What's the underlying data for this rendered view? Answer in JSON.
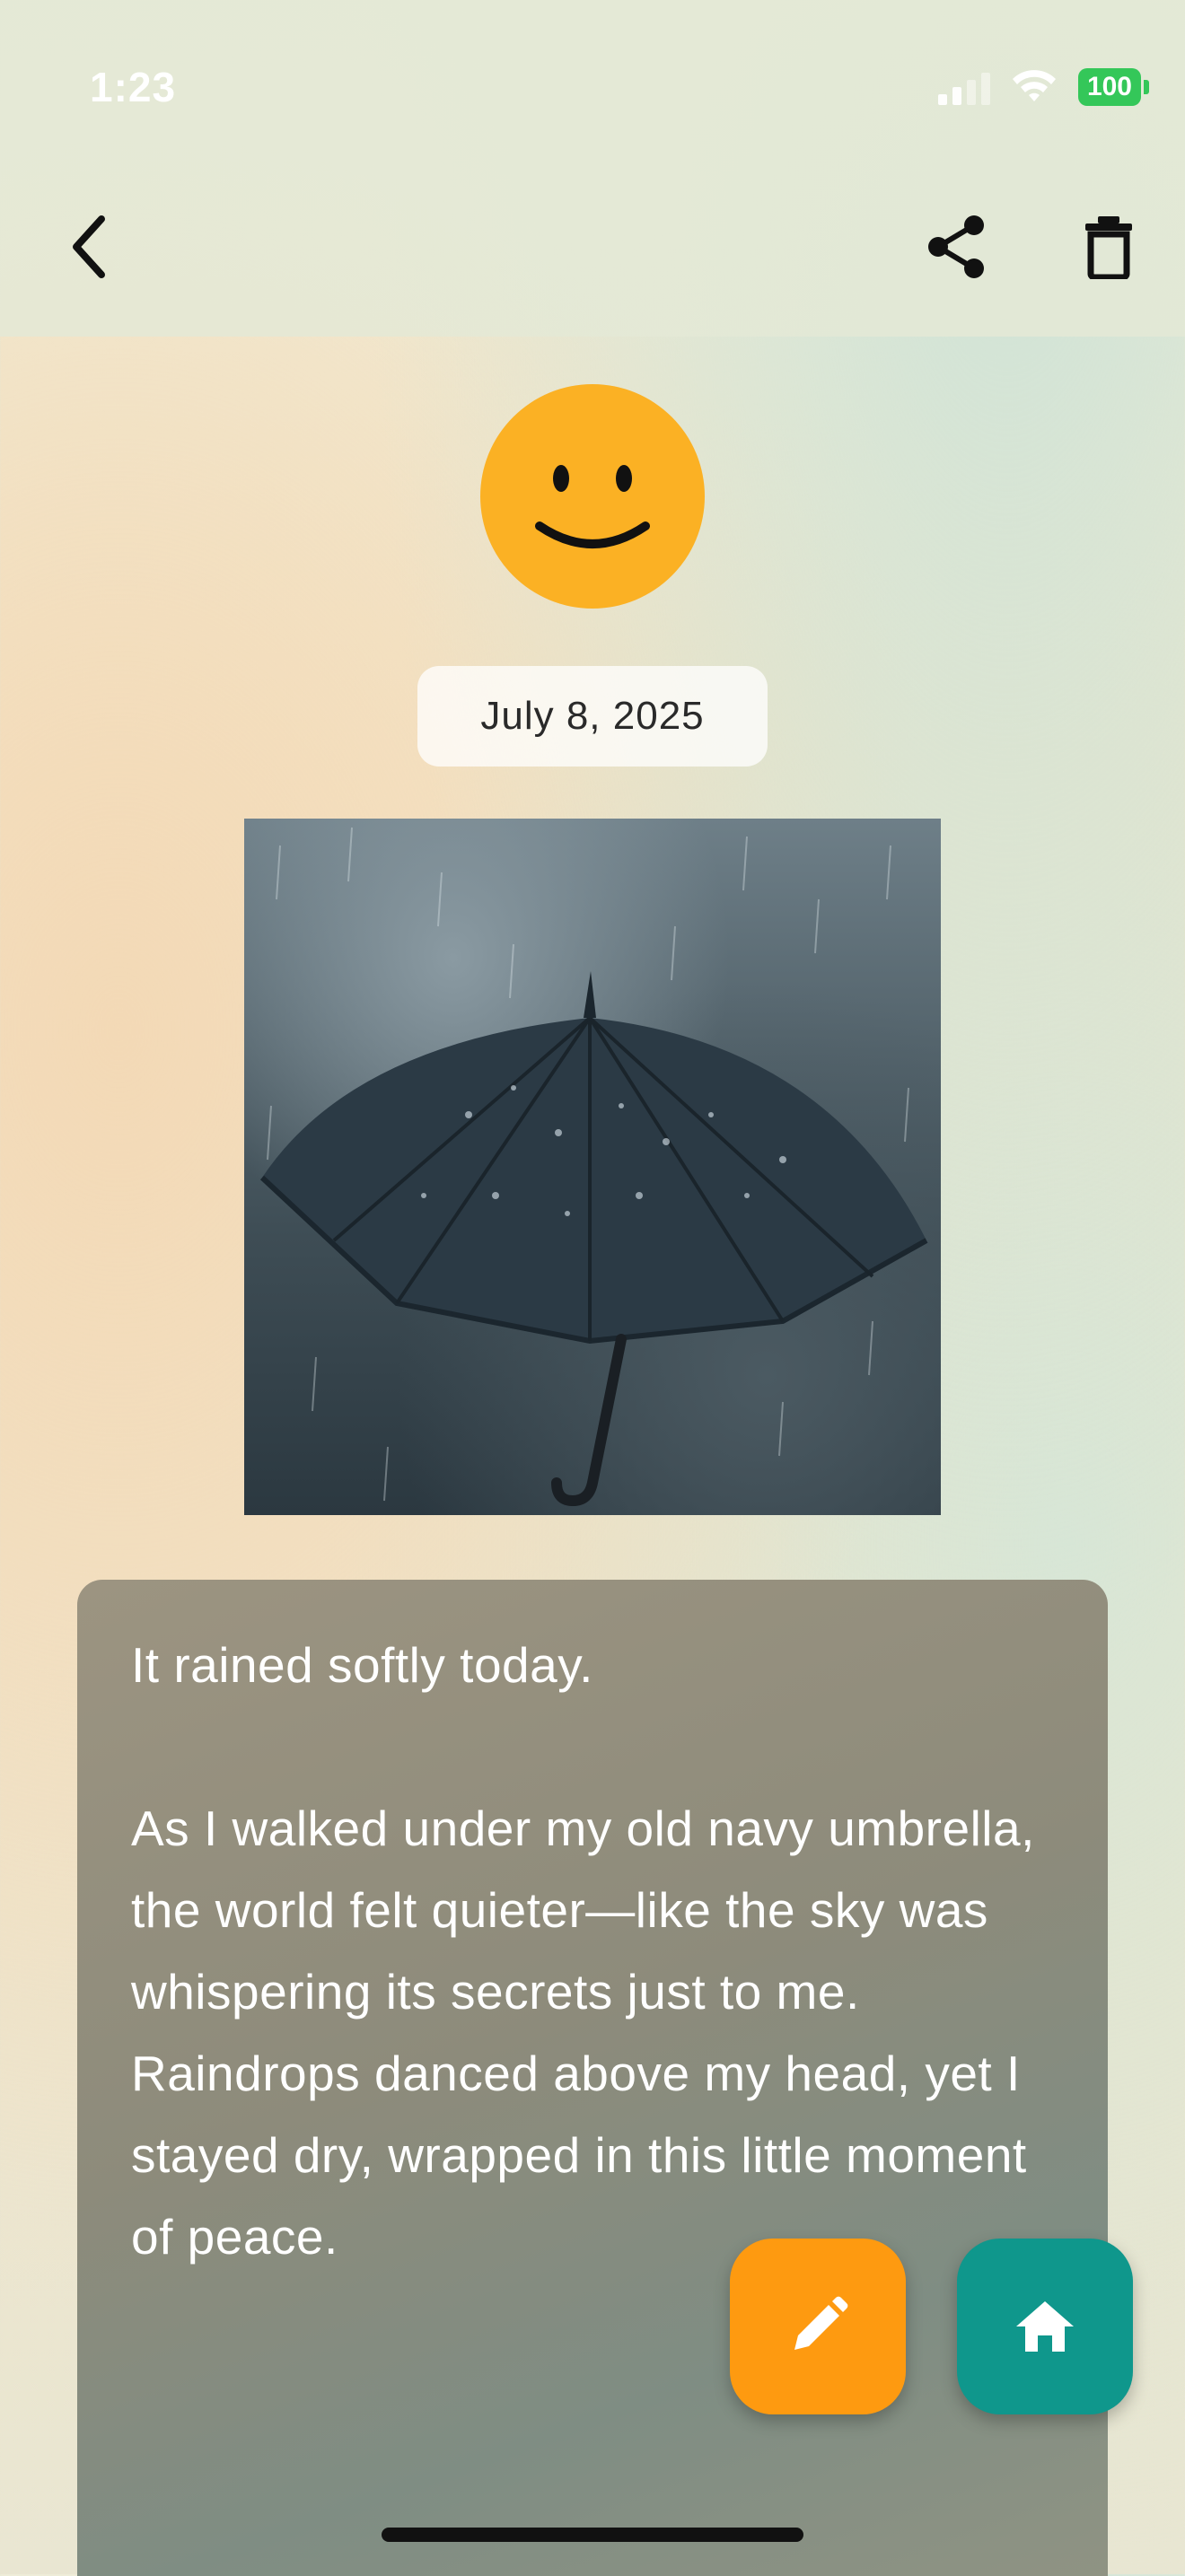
{
  "status_bar": {
    "time": "1:23",
    "battery": "100",
    "battery_color": "#34c759"
  },
  "toolbar": {
    "back_icon": "chevron-left-icon",
    "share_icon": "share-icon",
    "delete_icon": "trash-icon"
  },
  "entry": {
    "mood_icon": "smiley-face-icon",
    "mood_color": "#fbb124",
    "date": "July 8, 2025",
    "photo_subject": "umbrella-in-rain",
    "text": "It rained softly today.\n\nAs I walked under my old navy umbrella, the world felt quieter—like the sky was whispering its secrets just to me. Raindrops danced above my head, yet I stayed dry, wrapped in this little moment of peace."
  },
  "actions": {
    "edit_icon": "pencil-icon",
    "edit_color": "#fe9a10",
    "home_icon": "home-icon",
    "home_color": "#0f978c"
  }
}
